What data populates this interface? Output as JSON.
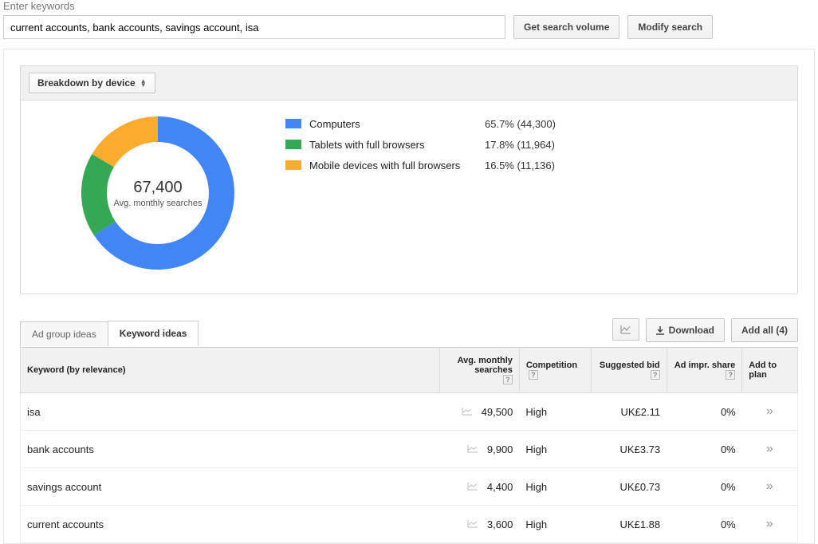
{
  "header": {
    "input_label": "Enter keywords",
    "input_value": "current accounts, bank accounts, savings account, isa",
    "btn_volume": "Get search volume",
    "btn_modify": "Modify search"
  },
  "breakdown": {
    "dropdown_label": "Breakdown by device",
    "center_value": "67,400",
    "center_label": "Avg. monthly searches",
    "legend": [
      {
        "label": "Computers",
        "value": "65.7% (44,300)",
        "color": "#4285f4"
      },
      {
        "label": "Tablets with full browsers",
        "value": "17.8% (11,964)",
        "color": "#34a853"
      },
      {
        "label": "Mobile devices with full browsers",
        "value": "16.5% (11,136)",
        "color": "#fbab2f"
      }
    ]
  },
  "chart_data": {
    "type": "pie",
    "title": "Breakdown by device",
    "center_label": "Avg. monthly searches",
    "total": 67400,
    "series": [
      {
        "name": "Computers",
        "value": 44300,
        "percent": 65.7,
        "color": "#4285f4"
      },
      {
        "name": "Tablets with full browsers",
        "value": 11964,
        "percent": 17.8,
        "color": "#34a853"
      },
      {
        "name": "Mobile devices with full browsers",
        "value": 11136,
        "percent": 16.5,
        "color": "#fbab2f"
      }
    ]
  },
  "tabs": {
    "adgroup": "Ad group ideas",
    "keyword": "Keyword ideas",
    "download": "Download",
    "addall": "Add all (4)"
  },
  "table": {
    "headers": {
      "keyword": "Keyword (by relevance)",
      "avg": "Avg. monthly searches",
      "comp": "Competition",
      "bid": "Suggested bid",
      "impr": "Ad impr. share",
      "plan": "Add to plan"
    },
    "rows": [
      {
        "keyword": "isa",
        "avg": "49,500",
        "comp": "High",
        "bid": "UK£2.11",
        "impr": "0%"
      },
      {
        "keyword": "bank accounts",
        "avg": "9,900",
        "comp": "High",
        "bid": "UK£3.73",
        "impr": "0%"
      },
      {
        "keyword": "savings account",
        "avg": "4,400",
        "comp": "High",
        "bid": "UK£0.73",
        "impr": "0%"
      },
      {
        "keyword": "current accounts",
        "avg": "3,600",
        "comp": "High",
        "bid": "UK£1.88",
        "impr": "0%"
      }
    ]
  }
}
